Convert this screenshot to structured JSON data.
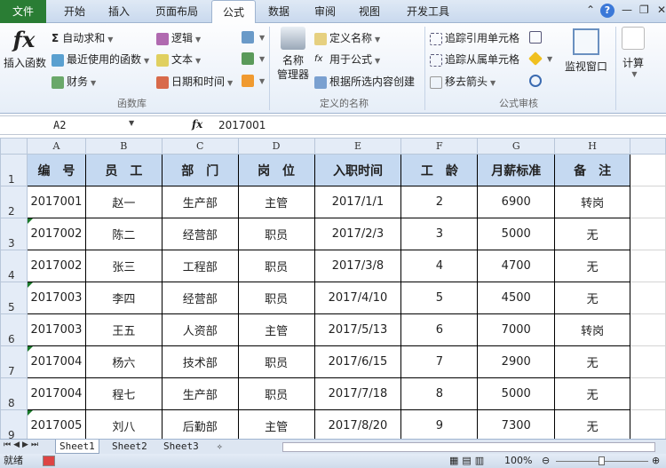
{
  "tabs": [
    "文件",
    "开始",
    "插入",
    "页面布局",
    "公式",
    "数据",
    "审阅",
    "视图",
    "开发工具"
  ],
  "ribbon": {
    "insert_function": "插入函数",
    "autosum": "自动求和",
    "recent": "最近使用的函数",
    "finance": "财务",
    "logic": "逻辑",
    "text": "文本",
    "datetime": "日期和时间",
    "group_lib": "函数库",
    "name_mgr_1": "名称",
    "name_mgr_2": "管理器",
    "define_name": "定义名称",
    "use_in_formula": "用于公式",
    "create_from_sel": "根据所选内容创建",
    "group_names": "定义的名称",
    "trace_precedents": "追踪引用单元格",
    "trace_dependents": "追踪从属单元格",
    "remove_arrows": "移去箭头",
    "group_audit": "公式审核",
    "watch_window": "监视窗口",
    "calc": "计算"
  },
  "formula_bar": {
    "name_box": "A2",
    "fx": "fx",
    "value": "2017001"
  },
  "columns": [
    "A",
    "B",
    "C",
    "D",
    "E",
    "F",
    "G",
    "H"
  ],
  "headers": [
    "编　号",
    "员　工",
    "部　门",
    "岗　位",
    "入职时间",
    "工　龄",
    "月薪标准",
    "备　注"
  ],
  "rows": [
    {
      "n": "2",
      "cells": [
        "2017001",
        "赵一",
        "生产部",
        "主管",
        "2017/1/1",
        "2",
        "6900",
        "转岗"
      ]
    },
    {
      "n": "3",
      "cells": [
        "2017002",
        "陈二",
        "经营部",
        "职员",
        "2017/2/3",
        "3",
        "5000",
        "无"
      ]
    },
    {
      "n": "4",
      "cells": [
        "2017002",
        "张三",
        "工程部",
        "职员",
        "2017/3/8",
        "4",
        "4700",
        "无"
      ]
    },
    {
      "n": "5",
      "cells": [
        "2017003",
        "李四",
        "经营部",
        "职员",
        "2017/4/10",
        "5",
        "4500",
        "无"
      ]
    },
    {
      "n": "6",
      "cells": [
        "2017003",
        "王五",
        "人资部",
        "主管",
        "2017/5/13",
        "6",
        "7000",
        "转岗"
      ]
    },
    {
      "n": "7",
      "cells": [
        "2017004",
        "杨六",
        "技术部",
        "职员",
        "2017/6/15",
        "7",
        "2900",
        "无"
      ]
    },
    {
      "n": "8",
      "cells": [
        "2017004",
        "程七",
        "生产部",
        "职员",
        "2017/7/18",
        "8",
        "5000",
        "无"
      ]
    },
    {
      "n": "9",
      "cells": [
        "2017005",
        "刘八",
        "后勤部",
        "主管",
        "2017/8/20",
        "9",
        "7300",
        "无"
      ]
    }
  ],
  "sheets": [
    "Sheet1",
    "Sheet2",
    "Sheet3"
  ],
  "status": {
    "ready": "就绪",
    "zoom": "100%"
  }
}
